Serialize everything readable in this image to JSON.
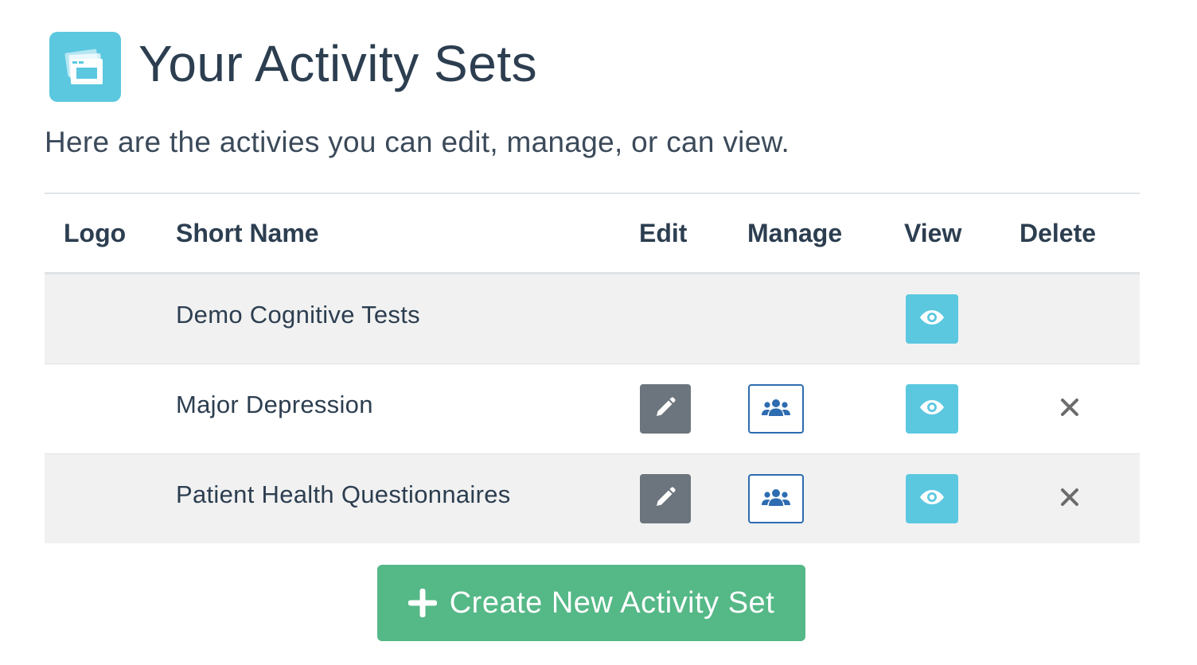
{
  "header": {
    "title": "Your Activity Sets",
    "subtitle": "Here are the activies you can edit, manage, or can view.",
    "logo_icon": "activity-sets-icon",
    "accent_color": "#5bc8e0"
  },
  "table": {
    "columns": {
      "logo": "Logo",
      "short_name": "Short Name",
      "edit": "Edit",
      "manage": "Manage",
      "view": "View",
      "delete": "Delete"
    },
    "rows": [
      {
        "short_name": "Demo Cognitive Tests",
        "can_edit": false,
        "can_manage": false,
        "can_view": true,
        "can_delete": false
      },
      {
        "short_name": "Major Depression",
        "can_edit": true,
        "can_manage": true,
        "can_view": true,
        "can_delete": true
      },
      {
        "short_name": "Patient Health Questionnaires",
        "can_edit": true,
        "can_manage": true,
        "can_view": true,
        "can_delete": true
      }
    ],
    "icons": {
      "edit": "pencil-icon",
      "manage": "users-icon",
      "view": "eye-icon",
      "delete": "close-icon"
    }
  },
  "actions": {
    "create_label": "Create New Activity Set",
    "create_icon": "plus-icon",
    "create_color": "#55b887"
  }
}
